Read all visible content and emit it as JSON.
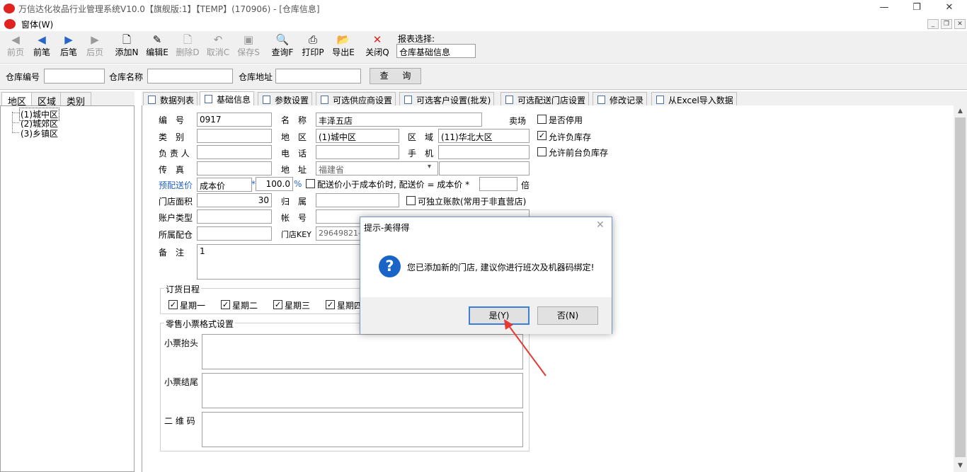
{
  "window": {
    "title": "万信达化妆品行业管理系统V10.0【旗舰版:1】【TEMP】(170906) - [仓库信息]",
    "menu": "窗体(W)"
  },
  "toolbar": {
    "buttons": [
      {
        "label": "前页",
        "icon": "first-page-icon",
        "glyph": "◀",
        "enabled": false
      },
      {
        "label": "前笔",
        "icon": "previous-icon",
        "glyph": "◀",
        "enabled": true
      },
      {
        "label": "后笔",
        "icon": "next-icon",
        "glyph": "▶",
        "enabled": true
      },
      {
        "label": "后页",
        "icon": "last-page-icon",
        "glyph": "▶",
        "enabled": false
      },
      {
        "label": "添加N",
        "icon": "add-icon",
        "glyph": "🗋",
        "enabled": true
      },
      {
        "label": "编辑E",
        "icon": "edit-icon",
        "glyph": "✎",
        "enabled": true
      },
      {
        "label": "删除D",
        "icon": "delete-icon",
        "glyph": "🗋",
        "enabled": false
      },
      {
        "label": "取消C",
        "icon": "undo-icon",
        "glyph": "↶",
        "enabled": false
      },
      {
        "label": "保存S",
        "icon": "save-icon",
        "glyph": "▣",
        "enabled": false
      },
      {
        "label": "查询F",
        "icon": "query-icon",
        "glyph": "🔍",
        "enabled": true
      },
      {
        "label": "打印P",
        "icon": "print-icon",
        "glyph": "⎙",
        "enabled": true
      },
      {
        "label": "导出E",
        "icon": "export-icon",
        "glyph": "📂",
        "enabled": true
      },
      {
        "label": "关闭Q",
        "icon": "close-icon",
        "glyph": "✕",
        "enabled": true
      }
    ],
    "report_label": "报表选择:",
    "report_value": "仓库基础信息"
  },
  "search": {
    "code_label": "仓库编号",
    "name_label": "仓库名称",
    "address_label": "仓库地址",
    "query_button": "查 询"
  },
  "left_tabs": [
    "地区",
    "区域",
    "类别"
  ],
  "tree": [
    "(1)城中区",
    "(2)城郊区",
    "(3)乡镇区"
  ],
  "right_tabs": [
    "数据列表",
    "基础信息",
    "参数设置",
    "可选供应商设置",
    "可选客户设置(批发)",
    "可选配送门店设置",
    "修改记录",
    "从Excel导入数据"
  ],
  "form": {
    "code_label": "编　号",
    "code_value": "0917",
    "name_label": "名　称",
    "name_value": "丰泽五店",
    "name_suffix": "卖场",
    "type_label": "类　别",
    "district_label": "地　区",
    "district_value": "(1)城中区",
    "area_label": "区　域",
    "area_value": "(11)华北大区",
    "manager_label": "负 责 人",
    "phone_label": "电　话",
    "mobile_label": "手　机",
    "fax_label": "传　真",
    "address_label": "地　址",
    "address_value": "福建省",
    "price_label": "预配送价",
    "price_basis": "成本价",
    "star": "*",
    "price_pct": "100.0",
    "pct": "%",
    "chk_below_cost": "配送价小于成本价时, 配送价 = 成本价 *",
    "times": "倍",
    "store_area_label": "门店面积",
    "store_area_value": "30",
    "belong_label": "归　属",
    "chk_independent": "可独立账款(常用于非直营店)",
    "acct_type_label": "账户类型",
    "acct_no_label": "帐　号",
    "warehouse_label": "所属配仓",
    "key_label": "门店KEY",
    "key_value": "29649821-8",
    "remark_label": "备　注",
    "remark_value": "1",
    "chk_disabled": "是否停用",
    "chk_negative": "允许负库存",
    "chk_front_negative": "允许前台负库存",
    "schedule_title": "订货日程",
    "days": [
      "星期一",
      "星期二",
      "星期三",
      "星期四"
    ],
    "receipt_title": "零售小票格式设置",
    "receipt_header": "小票抬头",
    "receipt_footer": "小票结尾",
    "qrcode": "二 维 码"
  },
  "dialog": {
    "title": "提示-美得得",
    "message": "您已添加新的门店, 建议你进行班次及机器码绑定!",
    "yes": "是(Y)",
    "no": "否(N)",
    "icon_glyph": "?",
    "close_glyph": "✕"
  },
  "colors": {
    "accent": "#1a64c8",
    "arrow": "#e53935",
    "logo": "#e0231e"
  }
}
